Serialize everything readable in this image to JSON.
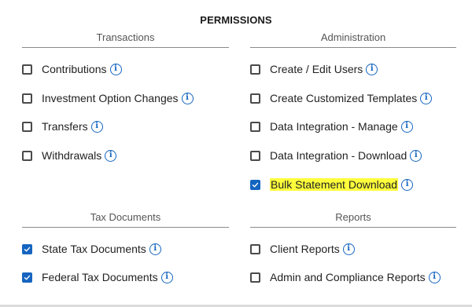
{
  "title": "PERMISSIONS",
  "sections": {
    "transactions": {
      "heading": "Transactions",
      "items": [
        {
          "label": "Contributions",
          "checked": false
        },
        {
          "label": "Investment Option Changes",
          "checked": false
        },
        {
          "label": "Transfers",
          "checked": false
        },
        {
          "label": "Withdrawals",
          "checked": false
        }
      ]
    },
    "administration": {
      "heading": "Administration",
      "items": [
        {
          "label": "Create / Edit Users",
          "checked": false
        },
        {
          "label": "Create Customized Templates",
          "checked": false
        },
        {
          "label": "Data Integration - Manage",
          "checked": false
        },
        {
          "label": "Data Integration - Download",
          "checked": false
        },
        {
          "label": "Bulk Statement Download",
          "checked": true,
          "highlighted": true
        }
      ]
    },
    "tax_documents": {
      "heading": "Tax Documents",
      "items": [
        {
          "label": "State Tax Documents",
          "checked": true
        },
        {
          "label": "Federal Tax Documents",
          "checked": true
        }
      ]
    },
    "reports": {
      "heading": "Reports",
      "items": [
        {
          "label": "Client Reports",
          "checked": false
        },
        {
          "label": "Admin and Compliance Reports",
          "checked": false
        }
      ]
    }
  },
  "info_glyph": "i",
  "colors": {
    "accent": "#1565c0",
    "highlight": "#ffff3c"
  }
}
